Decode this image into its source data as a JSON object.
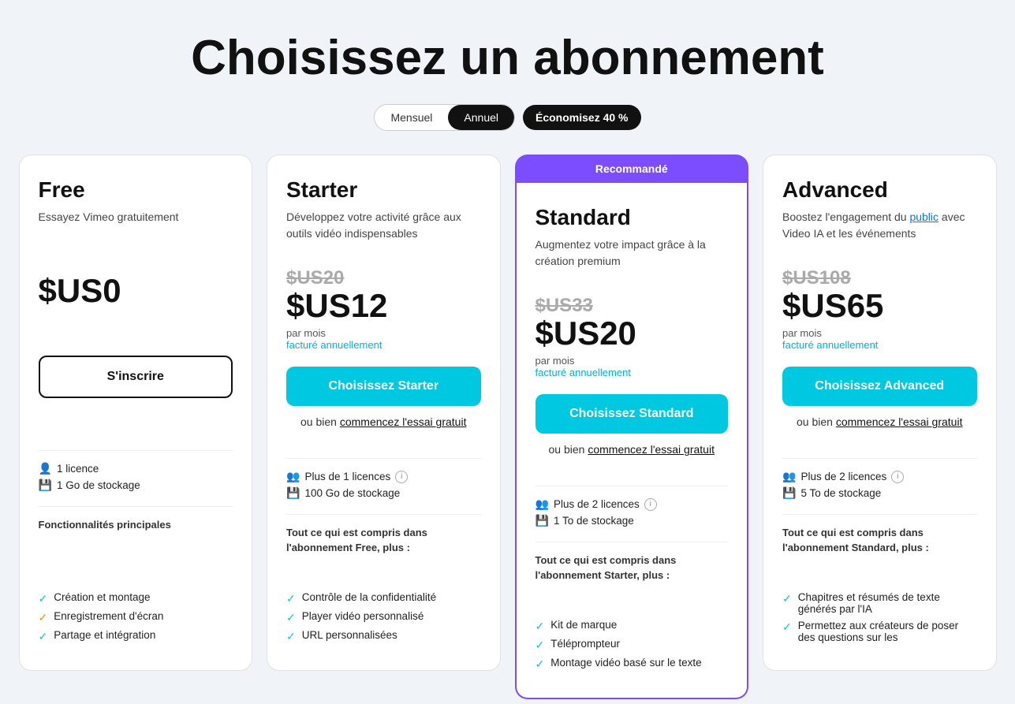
{
  "header": {
    "title": "Choisissez un abonnement"
  },
  "billing": {
    "monthly_label": "Mensuel",
    "annual_label": "Annuel",
    "active": "annual",
    "savings_badge": "Économisez 40 %"
  },
  "plans": [
    {
      "id": "free",
      "name": "Free",
      "description": "Essayez Vimeo gratuitement",
      "recommended": false,
      "recommended_label": "",
      "price_original": "",
      "price_current": "$US0",
      "price_period": "",
      "price_billing": "",
      "cta_label": "S'inscrire",
      "cta_style": "outline",
      "trial_text": "",
      "trial_link": "",
      "licenses": "1 licence",
      "storage": "1 Go de stockage",
      "features_header": "Fonctionnalités principales",
      "features": [
        {
          "text": "Création et montage",
          "color": "cyan"
        },
        {
          "text": "Enregistrement d'écran",
          "color": "orange"
        },
        {
          "text": "Partage et intégration",
          "color": "cyan"
        }
      ],
      "included_text": "",
      "included_features": []
    },
    {
      "id": "starter",
      "name": "Starter",
      "description": "Développez votre activité grâce aux outils vidéo indispensables",
      "recommended": false,
      "recommended_label": "",
      "price_original": "$US20",
      "price_current": "$US12",
      "price_period": "par mois",
      "price_billing": "facturé annuellement",
      "cta_label": "Choisissez Starter",
      "cta_style": "cyan",
      "trial_text": "ou bien ",
      "trial_link": "commencez l'essai gratuit",
      "licenses": "Plus de 1 licences",
      "storage": "100 Go de stockage",
      "features_header": "",
      "features": [],
      "included_text": "Tout ce qui est compris dans l'abonnement Free, plus :",
      "included_features": [
        {
          "text": "Contrôle de la confidentialité",
          "color": "cyan"
        },
        {
          "text": "Player vidéo personnalisé",
          "color": "cyan"
        },
        {
          "text": "URL personnalisées",
          "color": "cyan"
        }
      ]
    },
    {
      "id": "standard",
      "name": "Standard",
      "description": "Augmentez votre impact grâce à la création premium",
      "recommended": true,
      "recommended_label": "Recommandé",
      "price_original": "$US33",
      "price_current": "$US20",
      "price_period": "par mois",
      "price_billing": "facturé annuellement",
      "cta_label": "Choisissez Standard",
      "cta_style": "cyan",
      "trial_text": "ou bien ",
      "trial_link": "commencez l'essai gratuit",
      "licenses": "Plus de 2 licences",
      "storage": "1 To de stockage",
      "features_header": "",
      "features": [],
      "included_text": "Tout ce qui est compris dans l'abonnement Starter, plus :",
      "included_features": [
        {
          "text": "Kit de marque",
          "color": "cyan"
        },
        {
          "text": "Téléprompteur",
          "color": "cyan"
        },
        {
          "text": "Montage vidéo basé sur le texte",
          "color": "cyan"
        }
      ]
    },
    {
      "id": "advanced",
      "name": "Advanced",
      "description": "Boostez l'engagement du public avec Video IA et les événements",
      "recommended": false,
      "recommended_label": "",
      "price_original": "$US108",
      "price_current": "$US65",
      "price_period": "par mois",
      "price_billing": "facturé annuellement",
      "cta_label": "Choisissez Advanced",
      "cta_style": "cyan",
      "trial_text": "ou bien ",
      "trial_link": "commencez l'essai gratuit",
      "licenses": "Plus de 2 licences",
      "storage": "5 To de stockage",
      "features_header": "",
      "features": [],
      "included_text": "Tout ce qui est compris dans l'abonnement Standard, plus :",
      "included_features": [
        {
          "text": "Chapitres et résumés de texte générés par l'IA",
          "color": "cyan"
        },
        {
          "text": "Permettez aux créateurs de poser des questions sur les",
          "color": "cyan"
        }
      ]
    }
  ]
}
